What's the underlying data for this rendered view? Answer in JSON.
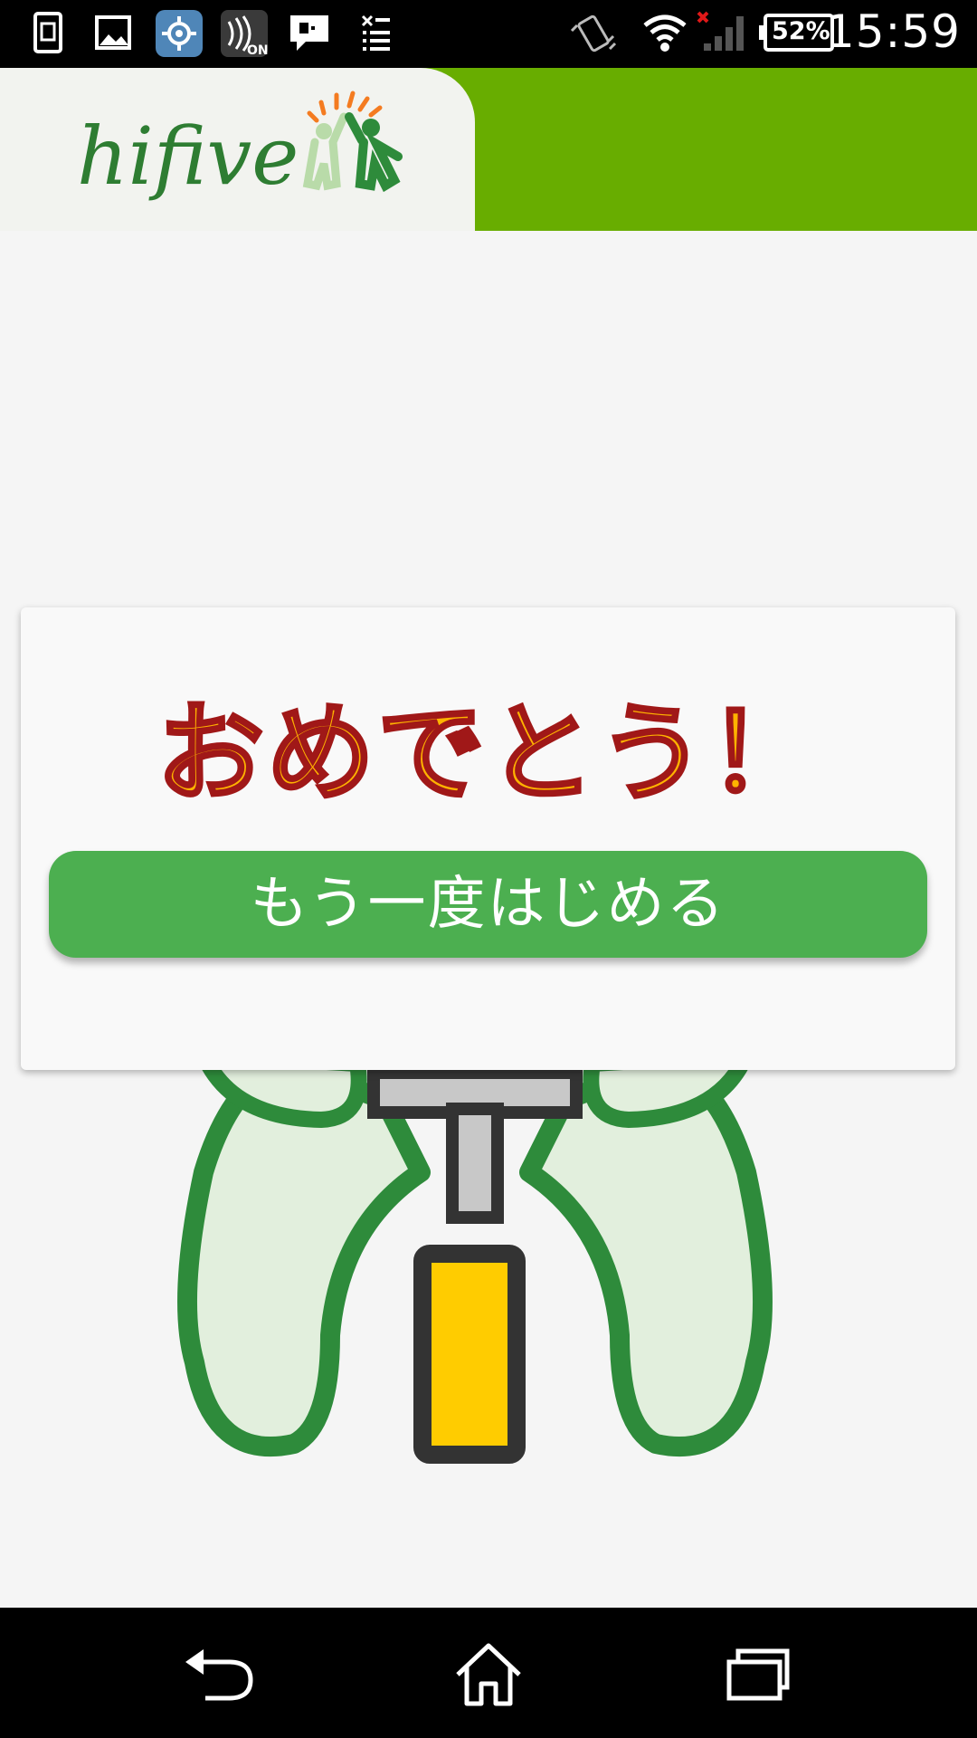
{
  "status_bar": {
    "time": "15:59",
    "battery": "52%",
    "notification_icons": [
      "sim-card-icon",
      "gallery-icon",
      "settings-app-icon",
      "nfc-on-icon",
      "message-icon",
      "download-list-icon"
    ],
    "system_icons": [
      "vibrate-icon",
      "wifi-icon",
      "no-signal-icon",
      "battery-icon"
    ]
  },
  "header": {
    "logo_text": "hifive",
    "accent_color": "#68ad00"
  },
  "dialog": {
    "title": "おめでとう！",
    "button_label": "もう一度はじめる",
    "button_color": "#4caf50"
  },
  "illustration": {
    "name": "robot-mascot",
    "colors": [
      "#2e8b3b",
      "#e2efdd",
      "#ffcc00",
      "#333333"
    ]
  },
  "nav_bar": {
    "buttons": [
      "back-icon",
      "home-icon",
      "recent-apps-icon"
    ]
  }
}
